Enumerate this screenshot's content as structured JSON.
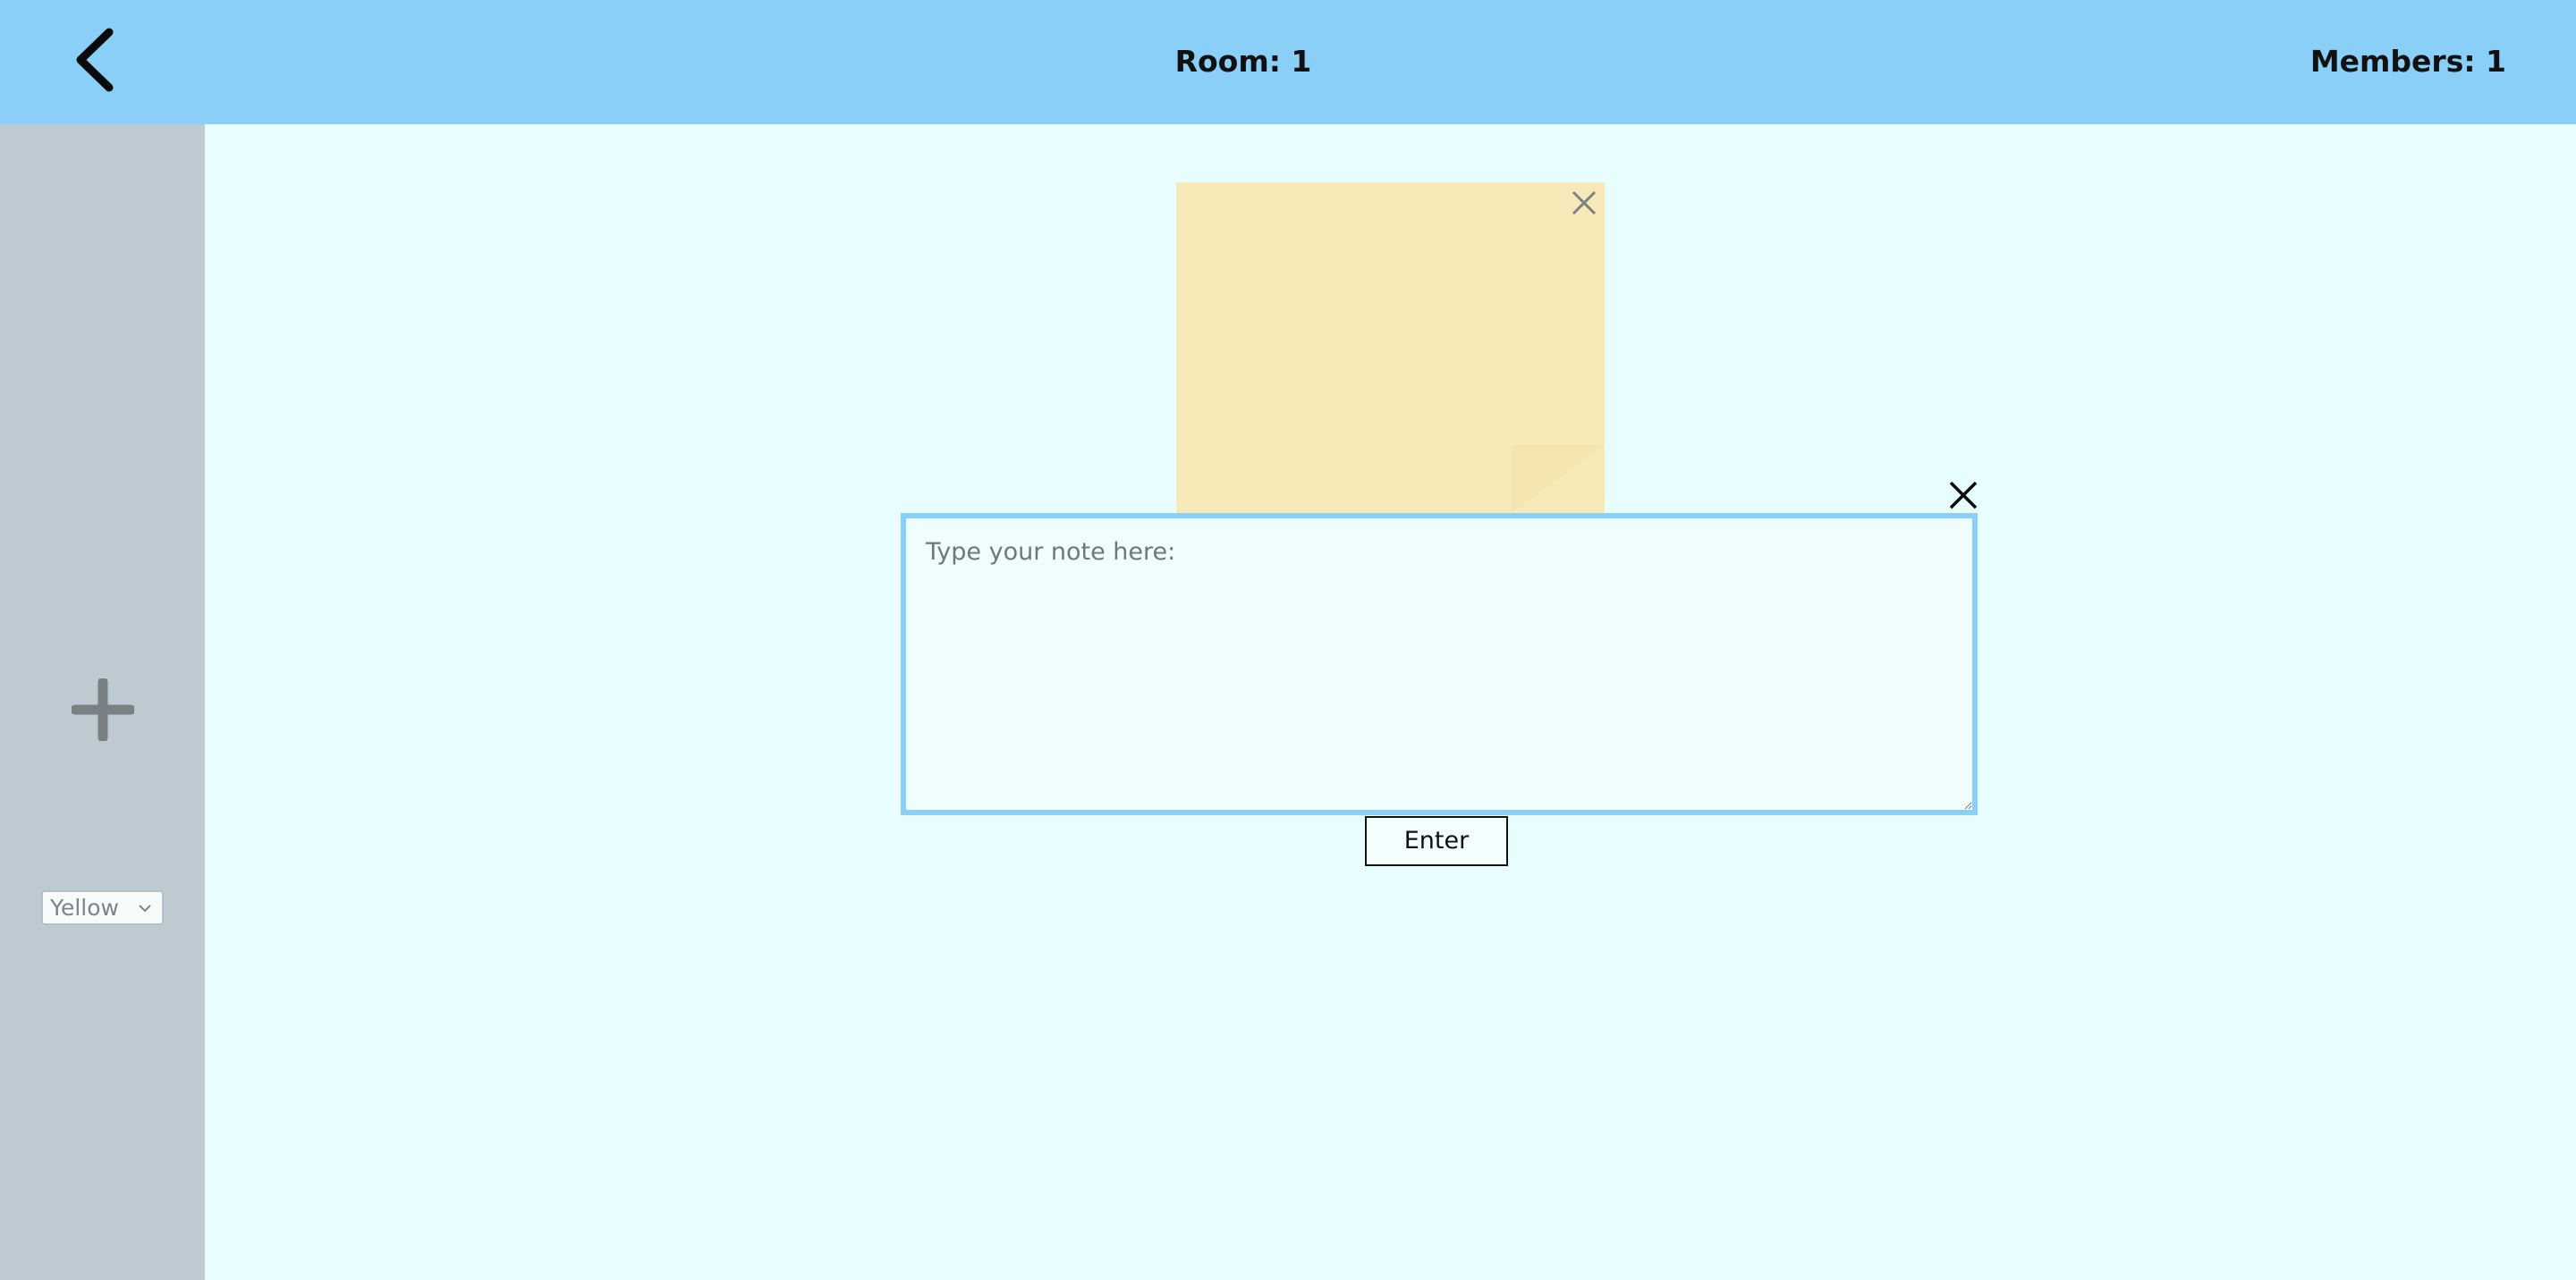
{
  "header": {
    "back_icon": "chevron-left-icon",
    "room_label": "Room: 1",
    "members_label": "Members: 1",
    "background_color": "#8acff8"
  },
  "sidebar": {
    "add_icon": "plus-icon",
    "color_select": {
      "selected": "Yellow"
    },
    "background_color": "#bdcad1"
  },
  "board": {
    "background_color": "#e8fdfd",
    "sticky_note": {
      "color": "#f8eab8",
      "close_icon": "close-icon"
    }
  },
  "editor": {
    "close_icon": "close-icon",
    "textarea_placeholder": "Type your note here:",
    "textarea_value": "",
    "enter_label": "Enter",
    "accent_color": "#8acff8"
  }
}
